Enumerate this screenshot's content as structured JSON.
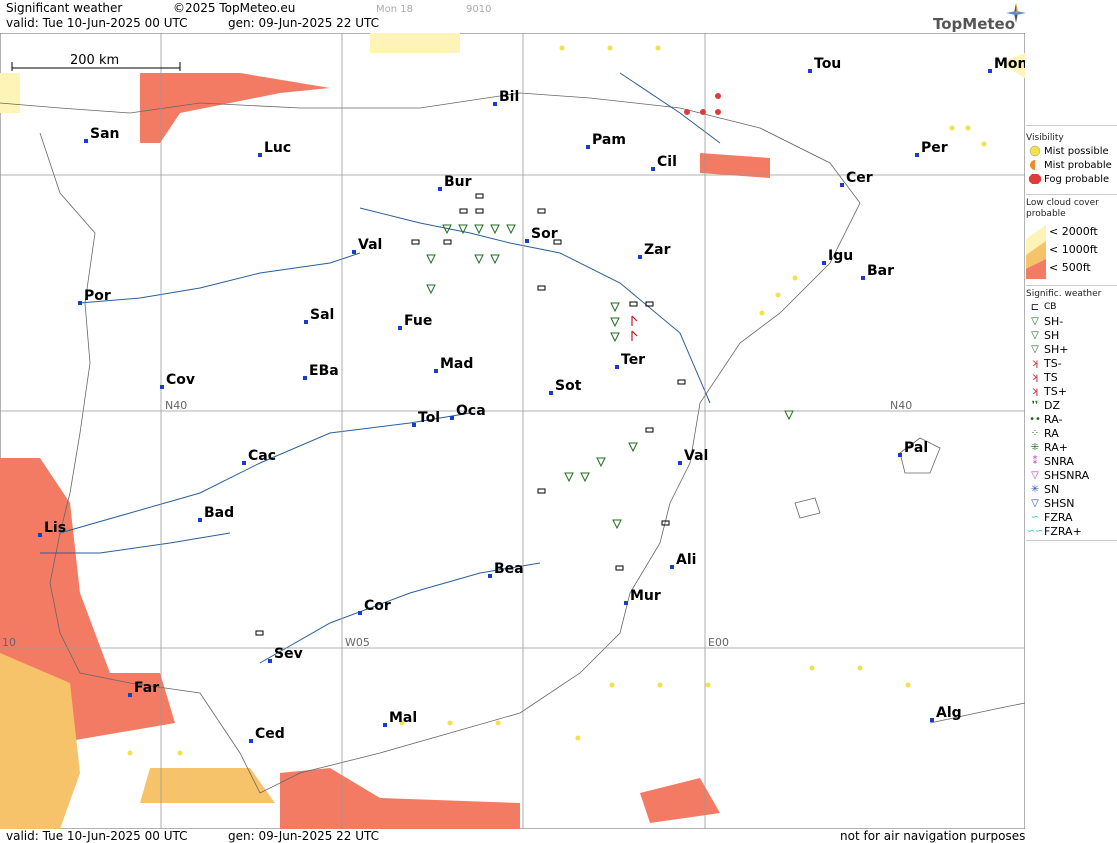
{
  "header": {
    "title": "Significant weather",
    "copyright": "©2025 TopMeteo.eu",
    "faint_a": "Mon 18",
    "faint_b": "9010",
    "valid": "valid:  Tue  10-Jun-2025  00 UTC",
    "gen": "gen: 09-Jun-2025 22 UTC",
    "logo": "TopMeteo"
  },
  "footer": {
    "valid": "valid:  Tue  10-Jun-2025  00 UTC",
    "gen": "gen: 09-Jun-2025 22 UTC",
    "disclaimer": "not for air navigation purposes"
  },
  "map": {
    "scale_label": "200 km",
    "grid_labels": [
      "N40",
      "N40",
      "W05",
      "E00",
      "10"
    ],
    "cities": [
      "Tou",
      "Mon",
      "Bil",
      "San",
      "Luc",
      "Pam",
      "Per",
      "Cil",
      "Bur",
      "Cer",
      "Sor",
      "Val",
      "Zar",
      "Igu",
      "Bar",
      "Por",
      "Sal",
      "Fue",
      "Mad",
      "Ter",
      "Cov",
      "EBa",
      "Sot",
      "Tol",
      "Oca",
      "Pal",
      "Val",
      "Cac",
      "Lis",
      "Bad",
      "Bea",
      "Ali",
      "Mur",
      "Cor",
      "Sev",
      "Far",
      "Mal",
      "Alg",
      "Ced"
    ]
  },
  "legend": {
    "visibility_title": "Visibility",
    "visibility": [
      "Mist possible",
      "Mist probable",
      "Fog probable"
    ],
    "lowcloud_title": "Low cloud cover probable",
    "lowcloud": [
      "< 2000ft",
      "< 1000ft",
      "<  500ft"
    ],
    "sigwx_title": "Signific. weather",
    "sigwx": [
      "CB",
      "SH-",
      "SH",
      "SH+",
      "TS-",
      "TS",
      "TS+",
      "DZ",
      "RA-",
      "RA",
      "RA+",
      "SNRA",
      "SHSNRA",
      "SN",
      "SHSN",
      "FZRA",
      "FZRA+"
    ],
    "colors": {
      "mist": "#f2e24a",
      "cloud2000": "#fff4b8",
      "cloud1000": "#f7c36a",
      "cloud500": "#f37b64",
      "fog": "#e03b3b",
      "rain": "#1f6e1f",
      "ts": "#c0202a",
      "sn": "#c040c0",
      "shsn": "#3050c0",
      "fzra": "#30c0c0"
    }
  }
}
